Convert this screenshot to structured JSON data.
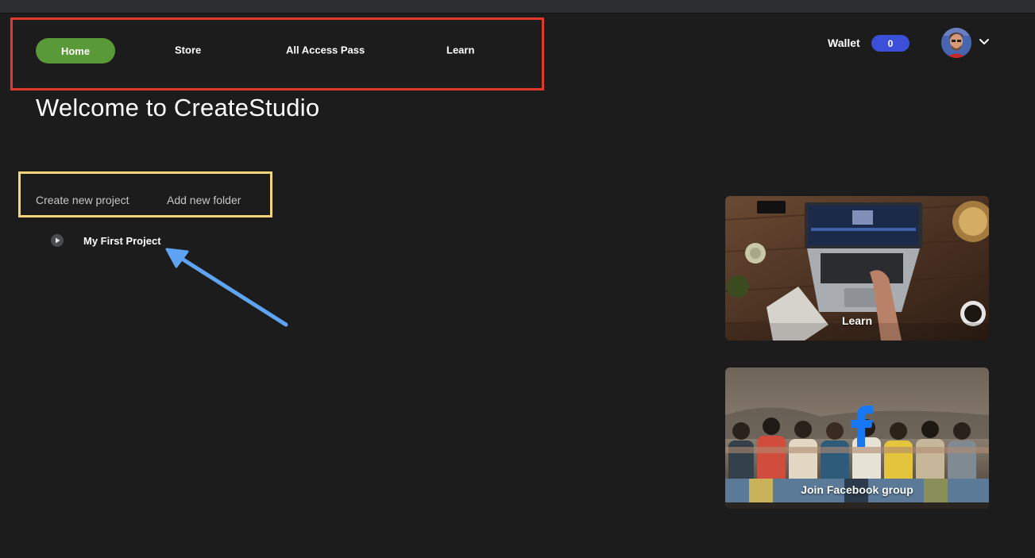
{
  "nav": {
    "items": [
      {
        "label": "Home",
        "active": true
      },
      {
        "label": "Store"
      },
      {
        "label": "All Access Pass"
      },
      {
        "label": "Learn"
      }
    ]
  },
  "header": {
    "wallet_label": "Wallet",
    "wallet_balance": "0"
  },
  "main": {
    "title": "Welcome to CreateStudio",
    "actions": {
      "create_project": "Create new project",
      "add_folder": "Add new folder"
    },
    "projects": [
      {
        "name": "My First Project"
      }
    ]
  },
  "cards": {
    "learn_label": "Learn",
    "facebook_label": "Join Facebook group"
  },
  "colors": {
    "accent_green": "#5a9937",
    "wallet_blue": "#3b4fd8",
    "annotation_red": "#e03a2c",
    "annotation_yellow": "#f4d47a",
    "annotation_arrow": "#5fa4f2",
    "facebook_blue": "#1877f2"
  },
  "icons": [
    "play-icon",
    "chevron-down-icon",
    "avatar",
    "facebook-icon",
    "arrow-annotation"
  ]
}
